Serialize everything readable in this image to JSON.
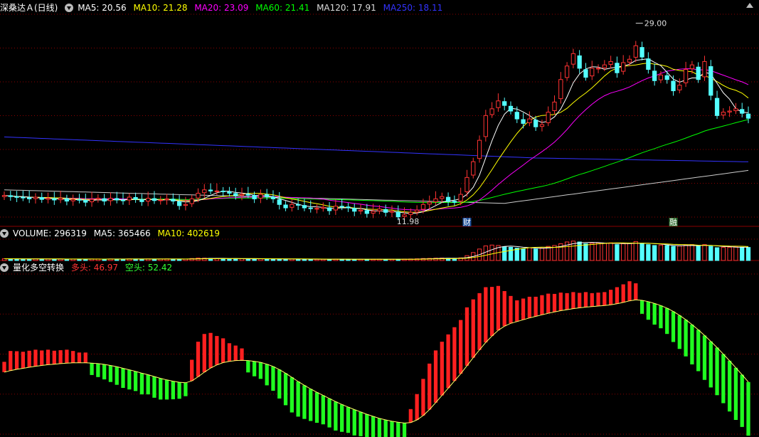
{
  "colors": {
    "bg": "#000000",
    "up": "#ff3333",
    "down": "#54ffff",
    "grid": "#8b0000",
    "ma5": "#ffffff",
    "ma10": "#ffff00",
    "ma20": "#ff00ff",
    "ma60": "#00ff00",
    "ma120": "#cccccc",
    "ma250": "#3333ff",
    "bull": "#ff2020",
    "bear": "#20ff20"
  },
  "price_header": {
    "stock": "深桑达Ａ(日线)",
    "ma5": "MA5: 20.56",
    "ma10": "MA10: 21.28",
    "ma20": "MA20: 23.09",
    "ma60": "MA60: 21.41",
    "ma120": "MA120: 17.91",
    "ma250": "MA250: 18.11"
  },
  "volume_header": {
    "vol": "VOLUME: 296319",
    "ma5": "MA5: 365466",
    "ma10": "MA10: 402619"
  },
  "indicator_header": {
    "name": "量化多空转换",
    "bull": "多头: 46.97",
    "bear": "空头: 52.42"
  },
  "annotations": {
    "high_label": "29.00",
    "low_label": "11.98",
    "marker_cai": "财",
    "marker_rong": "融"
  },
  "chart_data": {
    "type": "candlestick",
    "close": [
      13.7,
      13.6,
      13.55,
      13.5,
      13.4,
      13.55,
      13.35,
      13.45,
      13.3,
      13.45,
      13.2,
      13.35,
      13.3,
      13.1,
      13.35,
      13.45,
      13.2,
      13.45,
      13.3,
      13.25,
      13.55,
      13.35,
      13.15,
      13.45,
      13.25,
      13.3,
      13.4,
      13.2,
      12.8,
      12.9,
      13.4,
      13.9,
      14.2,
      14.1,
      14.1,
      14.05,
      13.9,
      13.7,
      13.8,
      13.75,
      13.4,
      13.8,
      13.6,
      13.4,
      12.9,
      12.6,
      12.9,
      12.85,
      12.6,
      12.55,
      12.55,
      12.65,
      12.35,
      12.75,
      12.7,
      12.6,
      12.3,
      12.4,
      12.1,
      12.3,
      12.5,
      12.2,
      12.3,
      11.8,
      11.98,
      12.2,
      12.4,
      12.9,
      13.1,
      13.4,
      13.6,
      13.2,
      13.1,
      13.8,
      15.3,
      16.7,
      18.6,
      20.8,
      21.4,
      22.1,
      21.7,
      21.2,
      20.5,
      20.1,
      20.5,
      19.8,
      20.0,
      21.1,
      22.0,
      24.0,
      25.2,
      26.3,
      25.0,
      24.2,
      25.0,
      25.0,
      25.3,
      25.6,
      24.6,
      25.5,
      25.8,
      27.0,
      26.0,
      24.9,
      23.9,
      24.4,
      24.0,
      23.0,
      23.5,
      24.9,
      25.3,
      24.0,
      25.6,
      22.6,
      20.8,
      21.1,
      21.2,
      21.4,
      21.0,
      20.56
    ],
    "volume": [
      40,
      38,
      36,
      35,
      34,
      36,
      33,
      35,
      32,
      34,
      31,
      33,
      33,
      30,
      34,
      35,
      32,
      35,
      33,
      32,
      36,
      34,
      32,
      35,
      33,
      34,
      36,
      33,
      30,
      32,
      45,
      55,
      52,
      48,
      46,
      42,
      40,
      38,
      39,
      38,
      36,
      40,
      38,
      36,
      34,
      32,
      33,
      31,
      30,
      29,
      28,
      30,
      28,
      31,
      30,
      29,
      27,
      28,
      26,
      27,
      29,
      26,
      28,
      27,
      30,
      34,
      38,
      45,
      48,
      52,
      55,
      50,
      48,
      60,
      110,
      180,
      260,
      330,
      350,
      340,
      310,
      300,
      280,
      270,
      290,
      260,
      280,
      320,
      340,
      380,
      420,
      440,
      420,
      380,
      390,
      400,
      390,
      400,
      360,
      380,
      390,
      430,
      390,
      360,
      340,
      350,
      340,
      320,
      330,
      350,
      360,
      330,
      360,
      320,
      290,
      300,
      300,
      310,
      300,
      296
    ],
    "dates_markers": [
      "财",
      "融"
    ],
    "price_range": [
      11.98,
      29.0
    ],
    "volume_ma5_last": 365466,
    "volume_ma10_last": 402619,
    "indicator": {
      "bull_last": 46.97,
      "bear_last": 52.42,
      "line": [
        52,
        52.6,
        53.1,
        53.5,
        53.9,
        54.3,
        54.6,
        54.9,
        55.1,
        55.3,
        55.5,
        55.6,
        55.6,
        55.6,
        55.5,
        55.3,
        55.0,
        54.6,
        54.1,
        53.5,
        52.9,
        52.3,
        51.6,
        51.0,
        50.3,
        49.6,
        49.0,
        48.5,
        48.1,
        47.9,
        48.6,
        50.2,
        52.0,
        53.6,
        54.8,
        55.7,
        56.2,
        56.5,
        56.6,
        56.5,
        56.2,
        55.8,
        55.1,
        54.2,
        53.0,
        51.6,
        50.0,
        48.4,
        46.9,
        45.5,
        44.2,
        43.0,
        41.8,
        40.6,
        39.5,
        38.5,
        37.5,
        36.6,
        35.7,
        34.9,
        34.1,
        33.5,
        33.0,
        32.6,
        32.3,
        32.5,
        33.5,
        35.2,
        37.5,
        40.2,
        43.0,
        45.8,
        48.6,
        51.4,
        54.5,
        57.6,
        60.6,
        63.5,
        66.0,
        68.2,
        69.8,
        70.9,
        71.6,
        72.3,
        73.0,
        73.6,
        74.2,
        74.8,
        75.3,
        75.8,
        76.2,
        76.6,
        76.9,
        77.2,
        77.4,
        77.6,
        77.8,
        78.1,
        78.5,
        79.0,
        79.6,
        80.0,
        79.8,
        79.3,
        78.6,
        77.8,
        76.8,
        75.5,
        74.0,
        72.3,
        70.4,
        68.4,
        66.2,
        63.9,
        61.5,
        59.0,
        56.4,
        53.7,
        51.0,
        48.2
      ],
      "ylim": [
        28,
        90
      ]
    }
  }
}
